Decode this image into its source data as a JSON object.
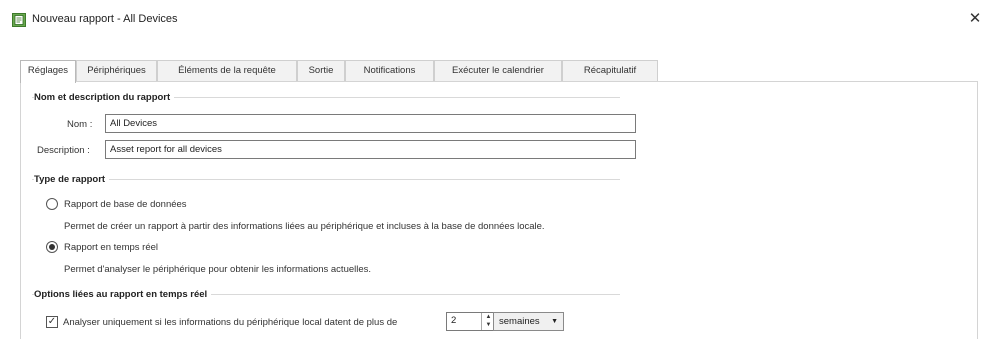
{
  "window": {
    "title": "Nouveau rapport - All Devices",
    "icon": "report-app-icon",
    "close_glyph": "✕"
  },
  "tabs": [
    {
      "label": "Réglages",
      "active": true
    },
    {
      "label": "Périphériques",
      "active": false
    },
    {
      "label": "Éléments de la requête",
      "active": false
    },
    {
      "label": "Sortie",
      "active": false
    },
    {
      "label": "Notifications",
      "active": false
    },
    {
      "label": "Exécuter le calendrier",
      "active": false
    },
    {
      "label": "Récapitulatif",
      "active": false
    }
  ],
  "name_section": {
    "title": "Nom et description du rapport",
    "name_label": "Nom :",
    "name_value": "All Devices",
    "description_label": "Description :",
    "description_value": "Asset report for all devices"
  },
  "type_section": {
    "title": "Type de rapport",
    "option_db_label": "Rapport de base de données",
    "option_db_desc": "Permet de créer un rapport à partir des informations liées au périphérique et incluses à la base de données locale.",
    "option_db_selected": false,
    "option_rt_label": "Rapport en temps réel",
    "option_rt_desc": "Permet d'analyser le périphérique pour obtenir les informations actuelles.",
    "option_rt_selected": true
  },
  "realtime_section": {
    "title": "Options liées au rapport en temps réel",
    "checkbox_label": "Analyser uniquement si les informations du périphérique local datent de plus de",
    "checkbox_checked": true,
    "check_glyph": "✓",
    "spinner_value": "2",
    "spin_up_glyph": "▲",
    "spin_down_glyph": "▼",
    "unit_value": "semaines",
    "unit_arrow": "▼"
  }
}
